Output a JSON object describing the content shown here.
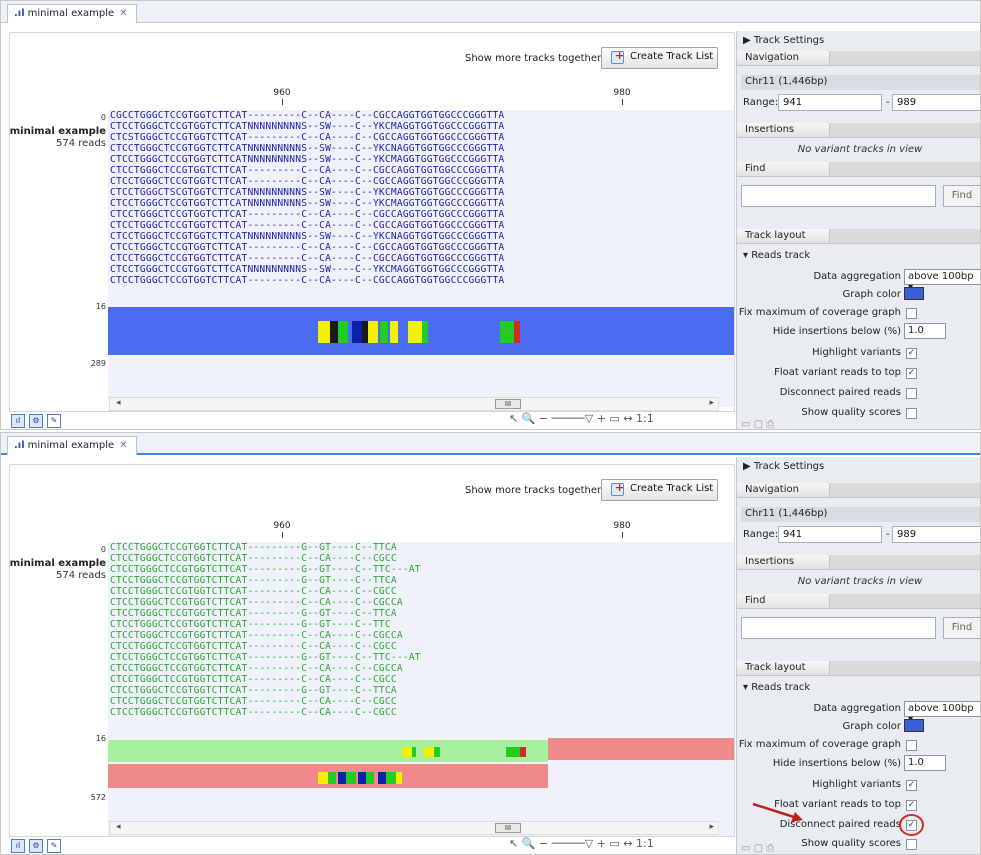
{
  "tab_title": "minimal example",
  "show_more_label": "Show more tracks together:",
  "create_track_list_label": "Create Track List",
  "ruler": {
    "left": "960",
    "right": "980"
  },
  "track": {
    "zero": "0",
    "name": "minimal example",
    "reads": "574 reads",
    "max_top": "16",
    "cov_low_top": "289",
    "cov_low_bottom": "572"
  },
  "top_reads": [
    "CGCCTGGGCTCCGTGGTCTTCAT---------C--CA----C--CGCCAGGTGGTGGCCCGGGTTA",
    "CTCCTGGGCTCCGTGGTCTTCATNNNNNNNNNS--SW----C--YKCMAGGTGGTGGCCCGGGTTA",
    "CTCSTGGGCTCCGTGGTCTTCAT---------C--CA----C--CGCCAGGTGGTGGCCCGGGTTA",
    "CTCCTGGGCTCCGTGGTCTTCATNNNNNNNNNS--SW----C--YKCNAGGTGGTGGCCCGGGTTA",
    "CTCCTGGGCTCCGTGGTCTTCATNNNNNNNNNS--SW----C--YKCMAGGTGGTGGCCCGGGTTA",
    "CTCCTGGGCTCCGTGGTCTTCAT---------C--CA----C--CGCCAGGTGGTGGCCCGGGTTA",
    "CTCCTGGGCTCCGTGGTCTTCAT---------C--CA----C--CGCCAGGTGGTGGCCCGGGTTA",
    "CTCCTGGGCTSCGTGGTCTTCATNNNNNNNNNS--SW----C--YKCMAGGTGGTGGCCCGGGTTA",
    "CTCCTGGGCTCCGTGGTCTTCATNNNNNNNNNS--SW----C--YKCMAGGTGGTGGCCCGGGTTA",
    "CTCCTGGGCTCCGTGGTCTTCAT---------C--CA----C--CGCCAGGTGGTGGCCCGGGTTA",
    "CTCCTGGGCTCCGTGGTCTTCAT---------C--CA----C--CGCCAGGTGGTGGCCCGGGTTA",
    "CTCCTGGGCTCCGTGGTCTTCATNNNNNNNNNS--SW----C--YKCNAGGTGGTGGCCCGGGTTA",
    "CTCCTGGGCTCCGTGGTCTTCAT---------C--CA----C--CGCCAGGTGGTGGCCCGGGTTA",
    "CTCCTGGGCTCCGTGGTCTTCAT---------C--CA----C--CGCCAGGTGGTGGCCCGGGTTA",
    "CTCCTGGGCTCCGTGGTCTTCATNNNNNNNNNS--SW----C--YKCMAGGTGGTGGCCCGGGTTA",
    "CTCCTGGGCTCCGTGGTCTTCAT---------C--CA----C--CGCCAGGTGGTGGCCCGGGTTA"
  ],
  "bottom_reads": [
    "CTCCTGGGCTCCGTGGTCTTCAT---------G--GT----C--TTCA",
    "CTCCTGGGCTCCGTGGTCTTCAT---------C--CA----C--CGCC",
    "CTCCTGGGCTCCGTGGTCTTCAT---------G--GT----C--TTC---AT",
    "CTCCTGGGCTCCGTGGTCTTCAT---------G--GT----C--TTCA",
    "CTCCTGGGCTCCGTGGTCTTCAT---------C--CA----C--CGCC",
    "CTCCTGGGCTCCGTGGTCTTCAT---------C--CA----C--CGCCA",
    "CTCCTGGGCTCCGTGGTCTTCAT---------G--GT----C--TTCA",
    "CTCCTGGGCTCCGTGGTCTTCAT---------G--GT----C--TTC",
    "CTCCTGGGCTCCGTGGTCTTCAT---------C--CA----C--CGCCA",
    "CTCCTGGGCTCCGTGGTCTTCAT---------C--CA----C--CGCC",
    "CTCCTGGGCTCCGTGGTCTTCAT---------G--GT----C--TTC---AT",
    "CTCCTGGGCTCCGTGGTCTTCAT---------C--CA----C--CGCCA",
    "CTCCTGGGCTCCGTGGTCTTCAT---------C--CA----C--CGCC",
    "CTCCTGGGCTCCGTGGTCTTCAT---------G--GT----C--TTCA",
    "CTCCTGGGCTCCGTGGTCTTCAT---------C--CA----C--CGCC",
    "CTCCTGGGCTCCGTGGTCTTCAT---------C--CA----C--CGCC"
  ],
  "scroll_thumb": "III",
  "settings": {
    "title": "Track Settings",
    "navigation": "Navigation",
    "chromosome": "Chr11 (1,446bp)",
    "range_label": "Range:",
    "range_from": "941",
    "range_to": "989",
    "range_dash": "-",
    "insertions": "Insertions",
    "no_variant": "No variant tracks in view",
    "find": "Find",
    "find_button": "Find",
    "track_layout": "Track layout",
    "reads_track": "Reads track",
    "data_aggregation": "Data aggregation",
    "aggregation_value": "above 100bp",
    "graph_color": "Graph color",
    "fix_max": "Fix maximum of coverage graph",
    "hide_insertions": "Hide insertions below (%)",
    "hide_insertions_value": "1.0",
    "highlight_variants": "Highlight variants",
    "float_variant": "Float variant reads to top",
    "disconnect_paired": "Disconnect paired reads",
    "show_quality": "Show quality scores"
  },
  "colors": {
    "coverage_blue": "#4a6cf0",
    "paired_green": "#a8f0a0",
    "unpaired_red": "#f08a8a",
    "highlight_red": "#d62828"
  },
  "icons": {
    "tab": "bar-chart-icon",
    "create": "add-track-list-icon",
    "check": "✓"
  }
}
